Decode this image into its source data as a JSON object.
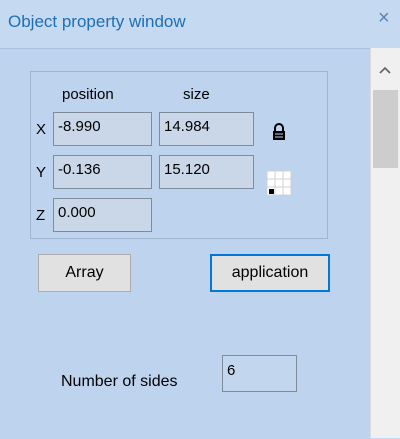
{
  "window": {
    "title": "Object property window",
    "close_glyph": "×"
  },
  "group": {
    "position_header": "position",
    "size_header": "size",
    "axes": {
      "x": "X",
      "y": "Y",
      "z": "Z"
    },
    "position": {
      "x": "-8.990",
      "y": "-0.136",
      "z": "0.000"
    },
    "size": {
      "x": "14.984",
      "y": "15.120"
    },
    "lock_icon": "lock-icon",
    "grid_icon": "grid-icon"
  },
  "buttons": {
    "array_label": "Array",
    "apply_label": "application"
  },
  "sides": {
    "label": "Number of sides",
    "value": "6"
  },
  "colors": {
    "background": "#c5d9f1",
    "title_text": "#1e6fb3",
    "focus_border": "#0078d7"
  }
}
